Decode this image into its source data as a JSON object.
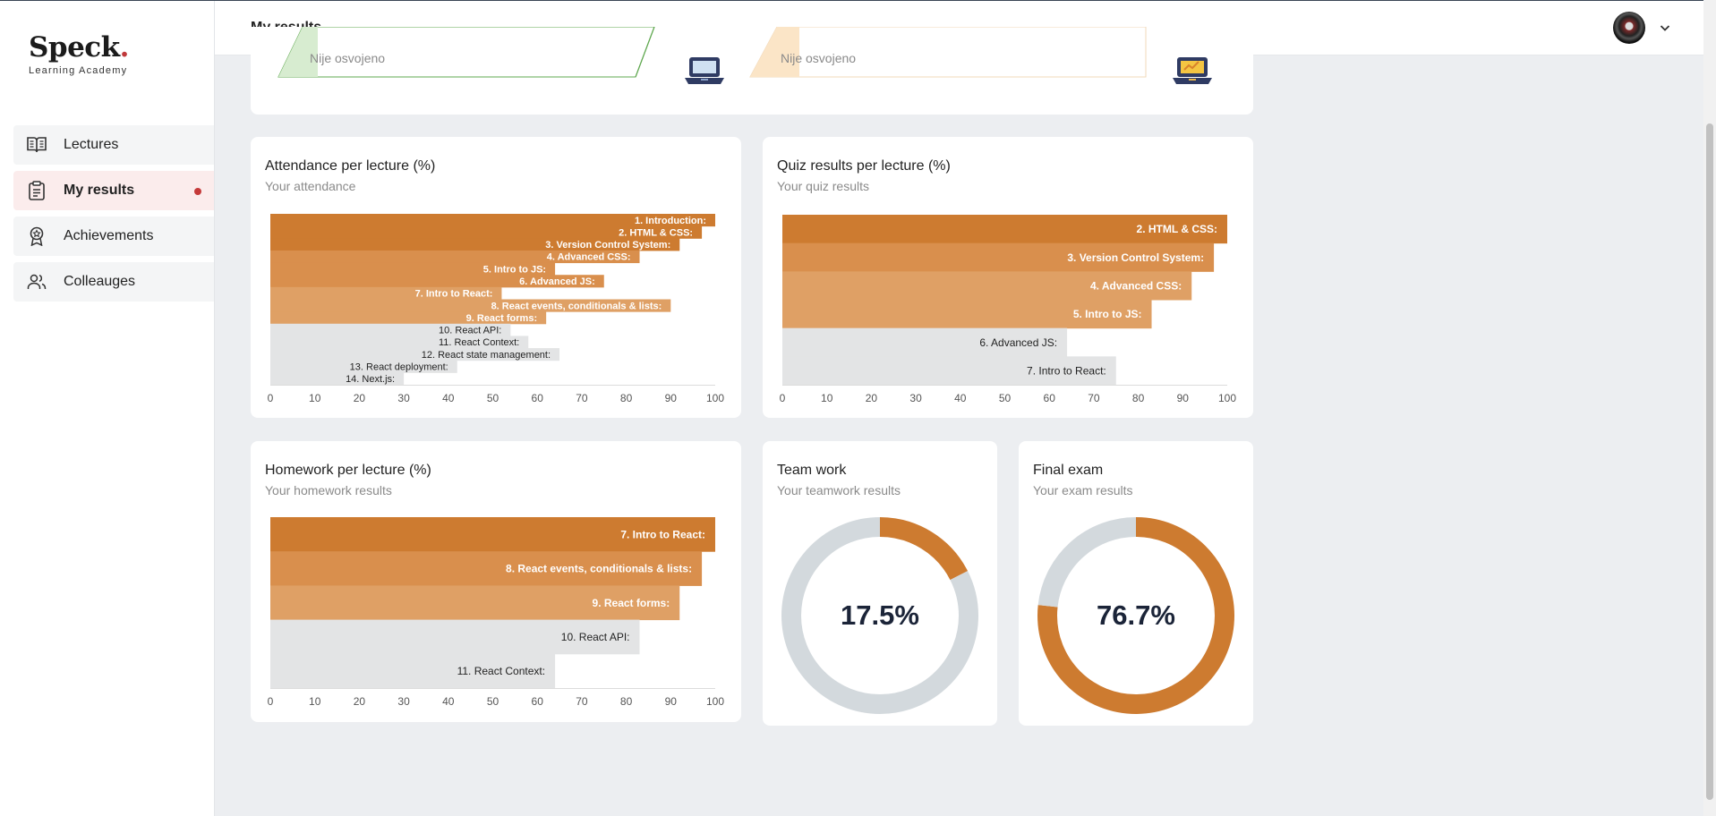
{
  "app": {
    "logo": "Speck",
    "logo_dot": ".",
    "logo_sub": "Learning Academy"
  },
  "sidebar": {
    "items": [
      {
        "label": "Lectures",
        "icon": "book-icon",
        "active": false
      },
      {
        "label": "My results",
        "icon": "clipboard-icon",
        "active": true,
        "notification": true
      },
      {
        "label": "Achievements",
        "icon": "award-icon",
        "active": false
      },
      {
        "label": "Colleauges",
        "icon": "users-icon",
        "active": false
      }
    ]
  },
  "header": {
    "title": "My results",
    "avatar_icon": "user-avatar",
    "menu_icon": "chevron-down-icon"
  },
  "achievements": {
    "items": [
      {
        "status": "Nije osvojeno",
        "icon": "laptop-icon",
        "color": "#5fa84f"
      },
      {
        "status": "Nije osvojeno",
        "icon": "laptop-icon",
        "color": "#e89a2c"
      }
    ]
  },
  "colors": {
    "primary": "#cd7b30",
    "mid": "#d98f4d",
    "light": "#dfa065",
    "grey": "#e3e4e5",
    "ring": "#d3d9dd"
  },
  "cards": {
    "attendance": {
      "title": "Attendance per lecture (%)",
      "subtitle": "Your attendance"
    },
    "quiz": {
      "title": "Quiz results per lecture (%)",
      "subtitle": "Your quiz results"
    },
    "homework": {
      "title": "Homework per lecture (%)",
      "subtitle": "Your homework results"
    },
    "teamwork": {
      "title": "Team work",
      "subtitle": "Your teamwork results",
      "value_label": "17.5%"
    },
    "exam": {
      "title": "Final exam",
      "subtitle": "Your exam results",
      "value_label": "76.7%"
    }
  },
  "chart_data": [
    {
      "type": "bar",
      "orientation": "horizontal",
      "title": "Attendance per lecture (%)",
      "subtitle": "Your attendance",
      "xlim": [
        0,
        100
      ],
      "xticks": [
        0,
        10,
        20,
        30,
        40,
        50,
        60,
        70,
        80,
        90,
        100
      ],
      "categories": [
        "1. Introduction:",
        "2. HTML & CSS:",
        "3. Version Control System:",
        "4. Advanced CSS:",
        "5. Intro to JS:",
        "6. Advanced JS:",
        "7. Intro to React:",
        "8. React events, conditionals & lists:",
        "9. React forms:",
        "10. React API:",
        "11. React Context:",
        "12. React state management:",
        "13. React deployment:",
        "14. Next.js:"
      ],
      "values": [
        100,
        97,
        92,
        83,
        64,
        75,
        52,
        90,
        62,
        54,
        58,
        65,
        42,
        30
      ],
      "shade": [
        "primary",
        "primary",
        "primary",
        "mid",
        "mid",
        "mid",
        "light",
        "light",
        "light",
        "grey",
        "grey",
        "grey",
        "grey",
        "grey"
      ]
    },
    {
      "type": "bar",
      "orientation": "horizontal",
      "title": "Quiz results per lecture (%)",
      "subtitle": "Your quiz results",
      "xlim": [
        0,
        100
      ],
      "xticks": [
        0,
        10,
        20,
        30,
        40,
        50,
        60,
        70,
        80,
        90,
        100
      ],
      "categories": [
        "2. HTML & CSS:",
        "3. Version Control System:",
        "4. Advanced CSS:",
        "5. Intro to JS:",
        "6. Advanced JS:",
        "7. Intro to React:"
      ],
      "values": [
        100,
        97,
        92,
        83,
        64,
        75
      ],
      "shade": [
        "primary",
        "mid",
        "light",
        "light",
        "grey",
        "grey"
      ]
    },
    {
      "type": "bar",
      "orientation": "horizontal",
      "title": "Homework per lecture (%)",
      "subtitle": "Your homework results",
      "xlim": [
        0,
        100
      ],
      "xticks": [
        0,
        10,
        20,
        30,
        40,
        50,
        60,
        70,
        80,
        90,
        100
      ],
      "categories": [
        "7. Intro to React:",
        "8. React events, conditionals & lists:",
        "9. React forms:",
        "10. React API:",
        "11. React Context:"
      ],
      "values": [
        100,
        97,
        92,
        83,
        64
      ],
      "shade": [
        "primary",
        "mid",
        "light",
        "grey",
        "grey"
      ]
    },
    {
      "type": "pie",
      "donut": true,
      "title": "Team work",
      "subtitle": "Your teamwork results",
      "values": [
        17.5,
        82.5
      ],
      "colors": [
        "#cd7b30",
        "#d3d9dd"
      ],
      "center_label": "17.5%"
    },
    {
      "type": "pie",
      "donut": true,
      "title": "Final exam",
      "subtitle": "Your exam results",
      "values": [
        76.7,
        23.3
      ],
      "colors": [
        "#cd7b30",
        "#d3d9dd"
      ],
      "center_label": "76.7%"
    }
  ]
}
